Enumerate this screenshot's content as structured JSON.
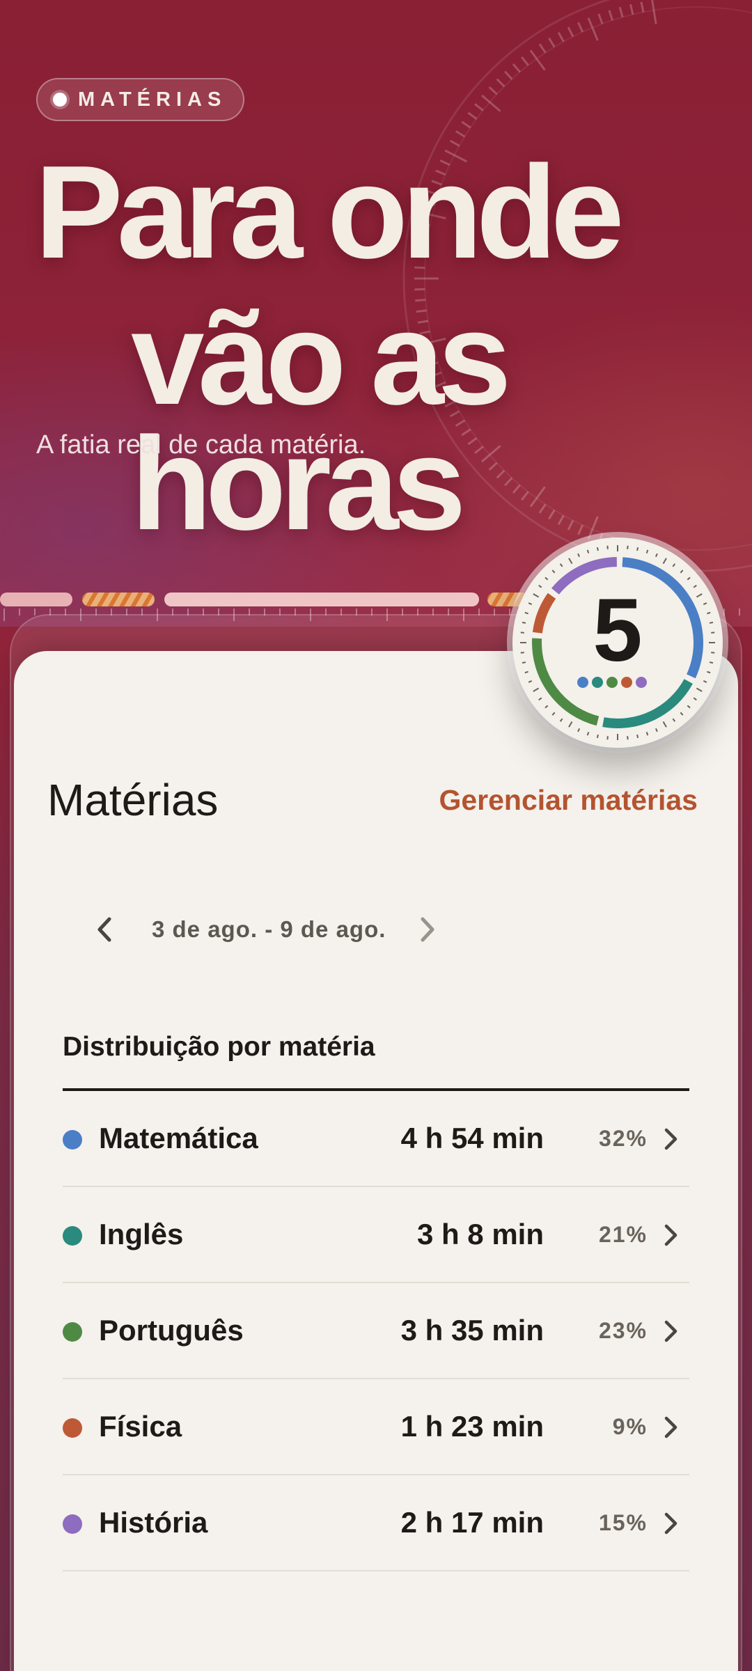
{
  "hero": {
    "chip_label": "MATÉRIAS",
    "headline_line1": "Para onde",
    "headline_line2": "vão as horas",
    "subtitle": "A fatia real de cada matéria."
  },
  "badge": {
    "count": "5",
    "dot_colors": [
      "#4a7fc6",
      "#2a8a7e",
      "#4f8a45",
      "#bd5a35",
      "#8e6cc0"
    ]
  },
  "page": {
    "title": "Matérias",
    "manage_label": "Gerenciar matérias"
  },
  "week_nav": {
    "range_label": "3 de ago. - 9 de ago.",
    "prev_icon": "chevron-left-icon",
    "next_icon": "chevron-right-icon"
  },
  "distribution": {
    "title": "Distribuição por matéria",
    "subjects": [
      {
        "name": "Matemática",
        "time": "4 h 54 min",
        "percent": "32%",
        "share": 0.32,
        "color": "#4a7fc6"
      },
      {
        "name": "Inglês",
        "time": "3 h 8 min",
        "percent": "21%",
        "share": 0.21,
        "color": "#2a8a7e"
      },
      {
        "name": "Português",
        "time": "3 h 35 min",
        "percent": "23%",
        "share": 0.23,
        "color": "#4f8a45"
      },
      {
        "name": "Física",
        "time": "1 h 23 min",
        "percent": "9%",
        "share": 0.09,
        "color": "#bd5a35"
      },
      {
        "name": "História",
        "time": "2 h 17 min",
        "percent": "15%",
        "share": 0.15,
        "color": "#8e6cc0"
      }
    ]
  },
  "colors": {
    "hero_background": "#8b2235",
    "accent": "#b35430",
    "card": "#f5f1ec",
    "text": "#1d1a18"
  }
}
